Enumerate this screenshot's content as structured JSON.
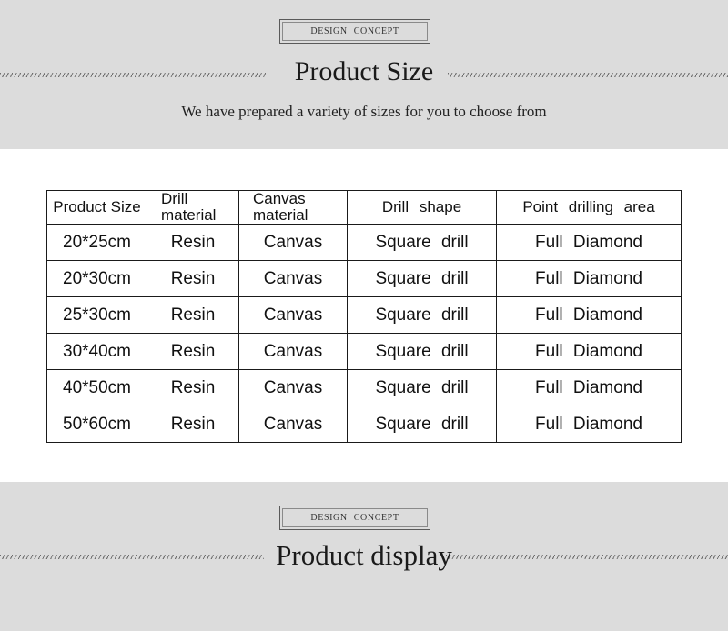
{
  "top_section": {
    "badge": "DESIGN CONCEPT",
    "title": "Product Size",
    "subtitle": "We have prepared a variety of sizes for you to choose from"
  },
  "size_table": {
    "headers": [
      "Product Size",
      "Drill material",
      "Canvas material",
      "Drill shape",
      "Point drilling area"
    ],
    "rows": [
      [
        "20*25cm",
        "Resin",
        "Canvas",
        "Square drill",
        "Full Diamond"
      ],
      [
        "20*30cm",
        "Resin",
        "Canvas",
        "Square drill",
        "Full Diamond"
      ],
      [
        "25*30cm",
        "Resin",
        "Canvas",
        "Square drill",
        "Full Diamond"
      ],
      [
        "30*40cm",
        "Resin",
        "Canvas",
        "Square drill",
        "Full Diamond"
      ],
      [
        "40*50cm",
        "Resin",
        "Canvas",
        "Square drill",
        "Full Diamond"
      ],
      [
        "50*60cm",
        "Resin",
        "Canvas",
        "Square drill",
        "Full Diamond"
      ]
    ]
  },
  "bottom_section": {
    "badge": "DESIGN CONCEPT",
    "title": "Product display"
  }
}
